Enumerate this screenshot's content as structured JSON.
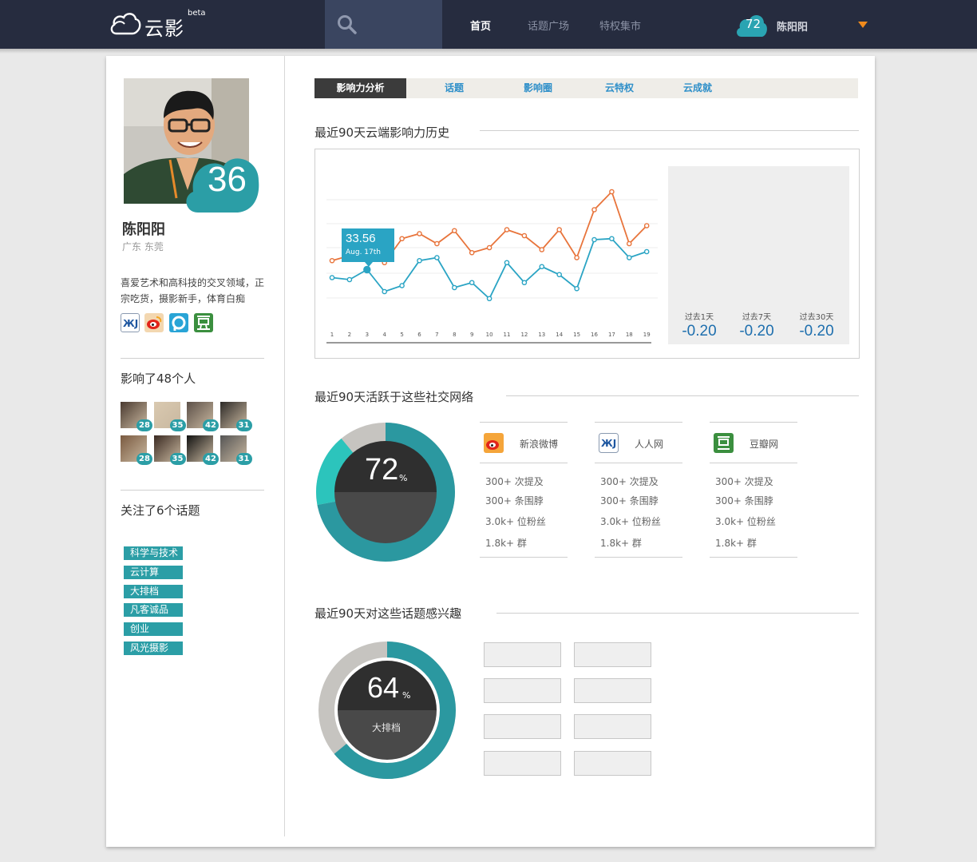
{
  "header": {
    "logo_text": "云影",
    "logo_badge": "beta",
    "nav": [
      {
        "label": "首页",
        "active": true
      },
      {
        "label": "话题广场",
        "active": false
      },
      {
        "label": "特权集市",
        "active": false
      }
    ],
    "user_score": "72",
    "user_name": "陈阳阳"
  },
  "profile": {
    "score": "36",
    "name": "陈阳阳",
    "location": "广东 东莞",
    "bio": "喜爱艺术和高科技的交叉领域，正宗吃货，摄影新手，体育白痴",
    "accounts": [
      "renren-icon",
      "weibo-icon",
      "pengyou-icon",
      "douban-icon"
    ]
  },
  "influence": {
    "title": "影响了48个人",
    "people": [
      "28",
      "35",
      "42",
      "31",
      "28",
      "35",
      "42",
      "31"
    ]
  },
  "topics_followed": {
    "title": "关注了6个话题",
    "tags": [
      "科学与技术",
      "云计算",
      "大排档",
      "凡客诚品",
      "创业",
      "风光摄影"
    ]
  },
  "tabs": [
    {
      "label": "影响力分析",
      "active": true
    },
    {
      "label": "话题",
      "active": false
    },
    {
      "label": "影响圈",
      "active": false
    },
    {
      "label": "云特权",
      "active": false
    },
    {
      "label": "云成就",
      "active": false
    }
  ],
  "history": {
    "title": "最近90天云端影响力历史",
    "tooltip_value": "33.56",
    "tooltip_date": "Aug. 17th",
    "stats": [
      {
        "label": "过去1天",
        "value": "-0.20"
      },
      {
        "label": "过去7天",
        "value": "-0.20"
      },
      {
        "label": "过去30天",
        "value": "-0.20"
      }
    ]
  },
  "chart_data": {
    "type": "line",
    "title": "",
    "x": [
      "1",
      "2",
      "3",
      "4",
      "5",
      "6",
      "7",
      "8",
      "9",
      "10",
      "11",
      "12",
      "13",
      "14",
      "15",
      "16",
      "17",
      "18",
      "19"
    ],
    "series": [
      {
        "name": "",
        "color": "#e8743b",
        "values": [
          3.5,
          4.0,
          4.6,
          3.3,
          5.7,
          6.2,
          5.2,
          6.5,
          4.3,
          4.8,
          6.6,
          6.0,
          4.6,
          6.6,
          3.8,
          8.6,
          10.4,
          5.2,
          7.0
        ]
      },
      {
        "name": "",
        "color": "#2aa4c4",
        "values": [
          1.8,
          1.6,
          2.6,
          0.4,
          1.0,
          3.5,
          3.8,
          0.8,
          1.3,
          -0.3,
          3.3,
          1.3,
          2.9,
          2.1,
          0.7,
          5.6,
          5.7,
          3.8,
          4.4
        ]
      }
    ],
    "highlight": {
      "series": 1,
      "index": 2
    },
    "ylim": [
      -2,
      12
    ],
    "grid": true
  },
  "networks": {
    "title": "最近90天活跃于这些社交网络",
    "percent": "72",
    "percent_sign": "%",
    "items": [
      {
        "name": "新浪微博",
        "icon": "weibo-icon",
        "rows": [
          "300+ 次提及",
          "300+ 条围脖",
          "3.0k+ 位粉丝",
          "1.8k+ 群"
        ]
      },
      {
        "name": "人人网",
        "icon": "renren-icon",
        "rows": [
          "300+ 次提及",
          "300+ 条围脖",
          "3.0k+ 位粉丝",
          "1.8k+ 群"
        ]
      },
      {
        "name": "豆瓣网",
        "icon": "douban-icon",
        "rows": [
          "300+ 次提及",
          "300+ 条围脖",
          "3.0k+ 位粉丝",
          "1.8k+ 群"
        ]
      }
    ]
  },
  "interests": {
    "title": "最近90天对这些话题感兴趣",
    "percent": "64",
    "percent_sign": "%",
    "label": "大排档"
  },
  "colors": {
    "teal": "#2b9ea6",
    "dark": "#262c3f",
    "orange": "#e8743b",
    "blue": "#2aa4c4"
  }
}
